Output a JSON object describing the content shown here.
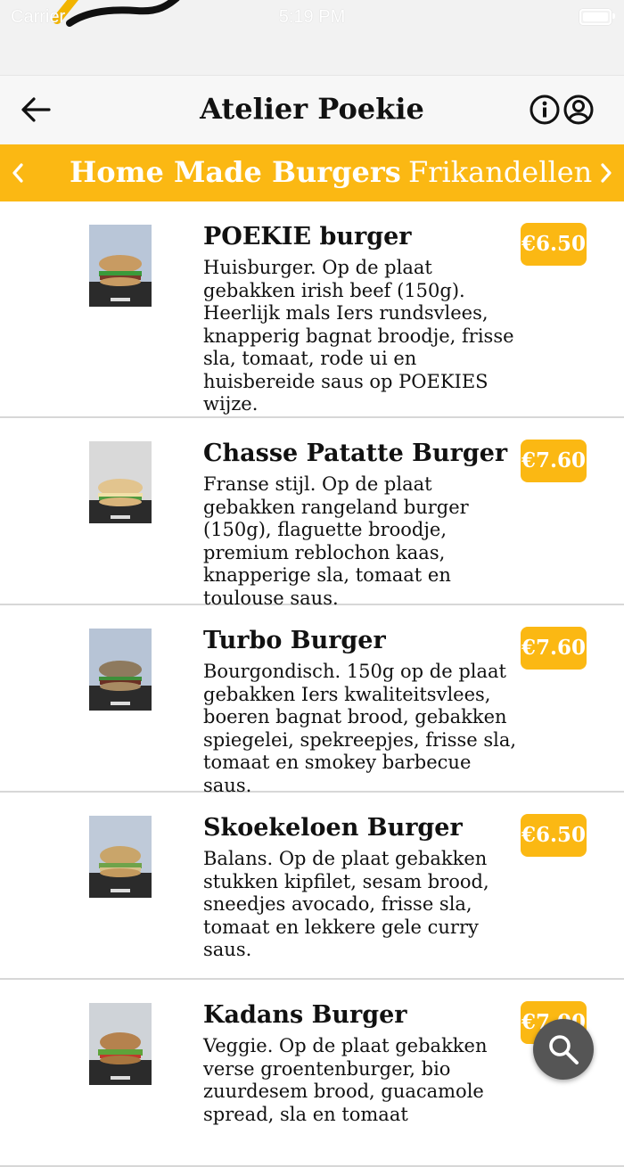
{
  "status": {
    "carrier": "Carrier",
    "time": "5:19 PM"
  },
  "header": {
    "title": "Atelier Poekie"
  },
  "categories": [
    {
      "label": "Home Made Burgers",
      "active": true
    },
    {
      "label": "Frikandellen",
      "active": false
    }
  ],
  "items": [
    {
      "name": "POEKIE burger",
      "description": "Huisburger. Op de plaat gebakken irish beef (150g). Heerlijk mals Iers rundsvlees, knapperig bagnat broodje, frisse sla, tomaat, rode ui en huisbereide saus op POEKIES wijze.",
      "price": "€6.50",
      "thumb_bg": "#b9c6d8"
    },
    {
      "name": "Chasse Patatte Burger",
      "description": "Franse stijl. Op de plaat gebakken rangeland burger (150g), flaguette broodje, premium reblochon kaas, knapperige sla, tomaat en toulouse saus.",
      "price": "€7.60",
      "thumb_bg": "#d9d9d9"
    },
    {
      "name": "Turbo Burger",
      "description": "Bourgondisch. 150g op de plaat gebakken Iers kwaliteitsvlees, boeren bagnat brood, gebakken spiegelei, spekreepjes, frisse sla, tomaat en smokey barbecue saus.",
      "price": "€7.60",
      "thumb_bg": "#b7c4d6"
    },
    {
      "name": "Skoekeloen Burger",
      "description": "Balans. Op de plaat gebakken stukken kipfilet, sesam brood, sneedjes avocado, frisse sla, tomaat en lekkere gele curry saus.",
      "price": "€6.50",
      "thumb_bg": "#bfcad9"
    },
    {
      "name": "Kadans Burger",
      "description": "Veggie. Op de plaat gebakken verse groentenburger, bio zuurdesem brood, guacamole spread, sla en tomaat",
      "price": "€7.00",
      "thumb_bg": "#cfd3d8"
    }
  ],
  "colors": {
    "accent": "#fbb813",
    "fab": "#555555"
  },
  "icons": {
    "back": "arrow-left-icon",
    "info": "info-icon",
    "account": "user-circle-icon",
    "search": "search-icon"
  }
}
